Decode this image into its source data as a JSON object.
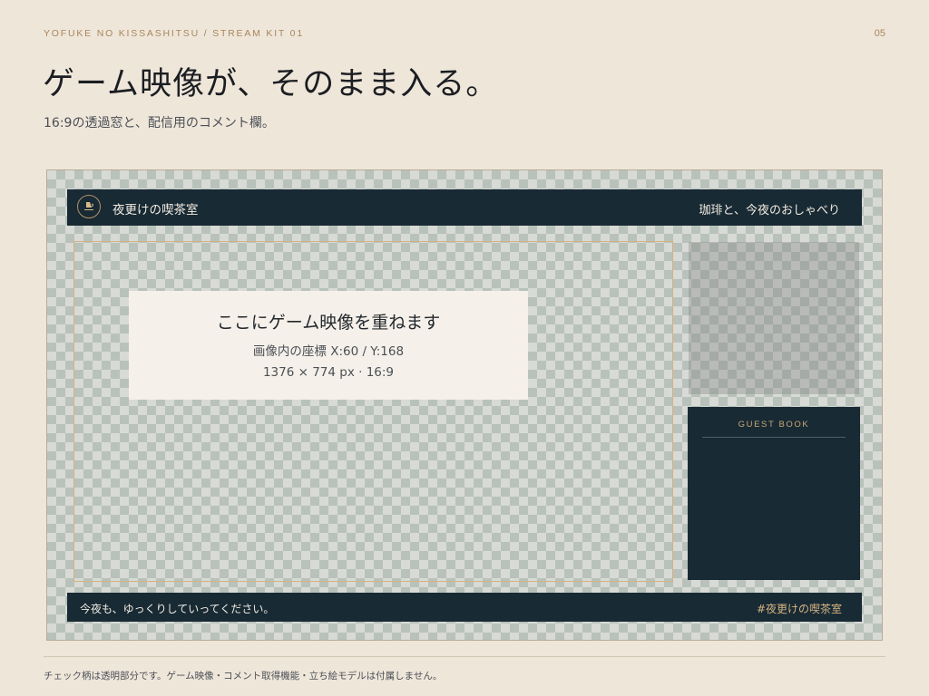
{
  "header": {
    "kicker": "YOFUKE NO KISSASHITSU  /  STREAM KIT 01",
    "page_number": "05",
    "title": "ゲーム映像が、そのまま入る。",
    "subtitle": "16:9の透過窓と、配信用のコメント欄。"
  },
  "overlay": {
    "top_bar": {
      "logo_icon": "cup-emblem-icon",
      "brand": "夜更けの喫茶室",
      "tagline": "珈琲と、今夜のおしゃべり"
    },
    "game_placeholder": {
      "title": "ここにゲーム映像を重ねます",
      "coords": "画像内の座標  X:60 / Y:168",
      "size": "1376 × 774 px  ·  16:9"
    },
    "guest_book": {
      "title": "GUEST BOOK"
    },
    "bottom_bar": {
      "welcome": "今夜も、ゆっくりしていってください。",
      "hashtag": "#夜更けの喫茶室"
    }
  },
  "footer": {
    "note": "チェック柄は透明部分です。ゲーム映像・コメント取得機能・立ち絵モデルは付属しません。"
  },
  "colors": {
    "background": "#efe6da",
    "navy": "#182a34",
    "accent_gold": "#c9a878",
    "checker_dark": "#b9c1bb",
    "checker_light": "#d8dad6"
  }
}
